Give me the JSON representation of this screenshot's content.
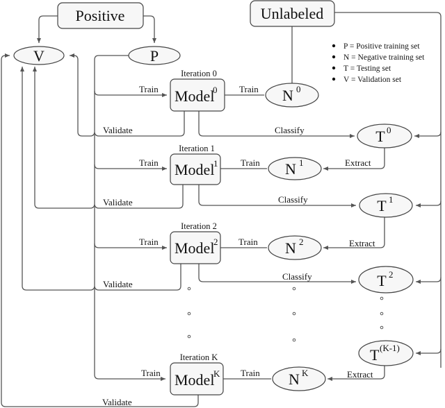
{
  "sources": {
    "positive": "Positive",
    "unlabeled": "Unlabeled"
  },
  "sets": {
    "V": "V",
    "P": "P"
  },
  "legend": [
    "P = Positive training set",
    "N = Negative training set",
    "T = Testing set",
    "V = Validation set"
  ],
  "edge_labels": {
    "train": "Train",
    "validate": "Validate",
    "classify": "Classify",
    "extract": "Extract"
  },
  "iterations": [
    {
      "title": "Iteration 0",
      "model": "Model",
      "model_sup": "0",
      "n": "N",
      "n_sup": "0",
      "t": "T",
      "t_sup": "0"
    },
    {
      "title": "Iteration 1",
      "model": "Model",
      "model_sup": "1",
      "n": "N",
      "n_sup": "1",
      "t": "T",
      "t_sup": "1"
    },
    {
      "title": "Iteration 2",
      "model": "Model",
      "model_sup": "2",
      "n": "N",
      "n_sup": "2",
      "t": "T",
      "t_sup": "2"
    },
    {
      "title": "Iteration K",
      "model": "Model",
      "model_sup": "K",
      "n": "N",
      "n_sup": "K",
      "t": "T",
      "t_sup": "(K-1)"
    }
  ]
}
